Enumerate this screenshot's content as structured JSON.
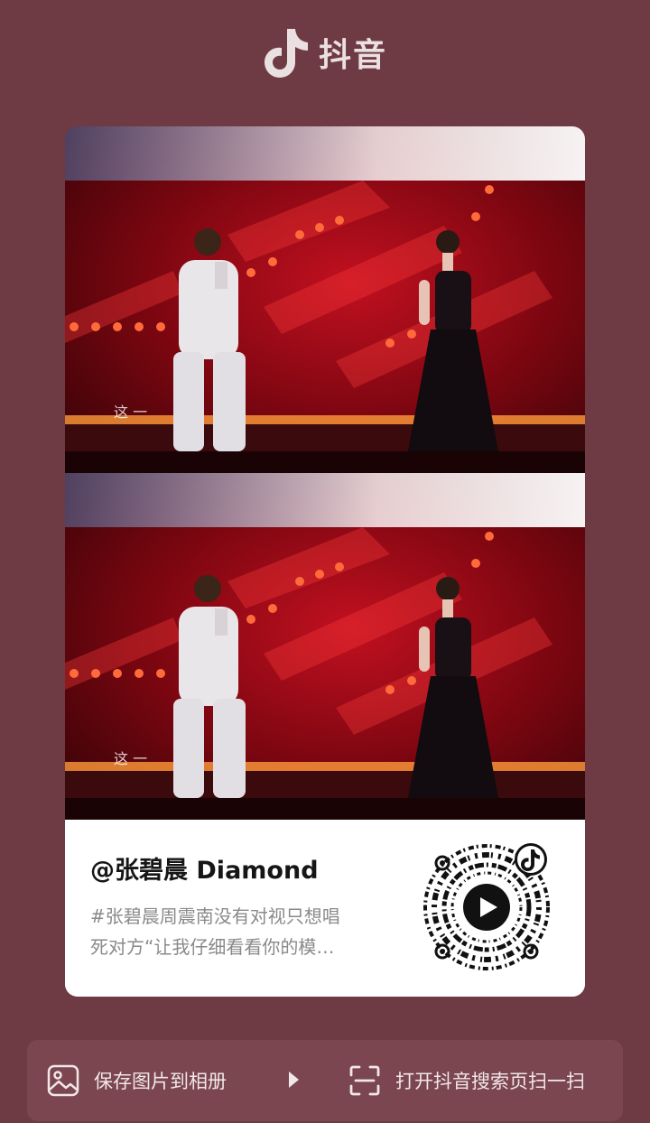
{
  "header": {
    "app_name": "抖音",
    "logo_icon": "douyin-note-icon"
  },
  "card": {
    "author": "@张碧晨 Diamond",
    "description_lines": [
      "#张碧晨周震南没有对视只想唱",
      "死对方“让我仔细看看你的模…"
    ],
    "photo_overlay_text": "这 一"
  },
  "actions": {
    "save_label": "保存图片到相册",
    "scan_label": "打开抖音搜索页扫一扫"
  },
  "colors": {
    "background": "#6e3a43",
    "bar": "#7b4650",
    "card": "#ffffff"
  }
}
